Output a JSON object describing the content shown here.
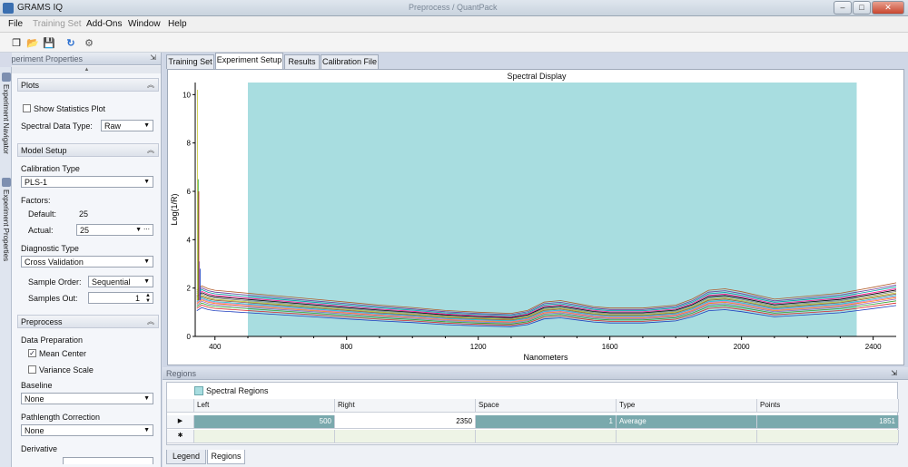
{
  "window": {
    "app_title": "GRAMS IQ",
    "doc_title": "Preprocess / QuantPack",
    "min": "–",
    "max": "□",
    "close": "✕"
  },
  "menu": [
    {
      "label": "File",
      "disabled": false
    },
    {
      "label": "Training Set",
      "disabled": true
    },
    {
      "label": "Add-Ons",
      "disabled": false
    },
    {
      "label": "Window",
      "disabled": false
    },
    {
      "label": "Help",
      "disabled": false
    }
  ],
  "toolbar": {
    "new_icon": "❐",
    "open_icon": "📂",
    "save_icon": "💾",
    "refresh_icon": "↻",
    "settings_icon": "⚙"
  },
  "side_tabs": {
    "navigator": "Experiment Navigator",
    "properties": "Experiment Properties"
  },
  "panel": {
    "title": "Experiment Properties",
    "pin": "⇲",
    "plots": {
      "header": "Plots",
      "show_statistics_label": "Show Statistics Plot",
      "show_statistics_checked": false,
      "spectral_type_label": "Spectral Data Type:",
      "spectral_type_value": "Raw"
    },
    "model": {
      "header": "Model Setup",
      "calibration_type_label": "Calibration Type",
      "calibration_type_value": "PLS-1",
      "factors_label": "Factors:",
      "default_label": "Default:",
      "default_value": "25",
      "actual_label": "Actual:",
      "actual_value": "25",
      "diagnostic_label": "Diagnostic Type",
      "diagnostic_value": "Cross Validation",
      "sample_order_label": "Sample Order:",
      "sample_order_value": "Sequential",
      "samples_out_label": "Samples Out:",
      "samples_out_value": "1"
    },
    "preprocess": {
      "header": "Preprocess",
      "data_prep_label": "Data Preparation",
      "mean_center_label": "Mean Center",
      "mean_center_checked": true,
      "variance_scale_label": "Variance Scale",
      "variance_scale_checked": false,
      "baseline_label": "Baseline",
      "baseline_value": "None",
      "pathlength_label": "Pathlength Correction",
      "pathlength_value": "None",
      "derivative_label": "Derivative"
    }
  },
  "doc_tabs": [
    {
      "label": "Training Set",
      "active": false
    },
    {
      "label": "Experiment Setup",
      "active": true
    },
    {
      "label": "Results",
      "active": false
    },
    {
      "label": "Calibration File",
      "active": false
    }
  ],
  "chart_data": {
    "type": "line",
    "title": "Spectral Display",
    "xlabel": "Nanometers",
    "ylabel": "Log(1/R)",
    "xlim": [
      340,
      2470
    ],
    "ylim": [
      0,
      10.5
    ],
    "x_ticks": [
      400,
      800,
      1200,
      1600,
      2000,
      2400
    ],
    "y_ticks": [
      0,
      2,
      4,
      6,
      8,
      10
    ],
    "shaded_region": {
      "x_start": 500,
      "x_end": 2350,
      "color": "#a8dde0"
    },
    "series_colors": [
      "#1f3fbf",
      "#d62728",
      "#2ca02c",
      "#9467bd",
      "#ff7f0e",
      "#e377c2",
      "#17becf",
      "#8c564b",
      "#bcbd22",
      "#7f7f7f",
      "#000000",
      "#ff1493",
      "#00a0a0",
      "#6a3d9a",
      "#b15928"
    ],
    "representative_curve": {
      "x": [
        345,
        360,
        380,
        400,
        500,
        600,
        700,
        800,
        900,
        1000,
        1100,
        1200,
        1300,
        1350,
        1400,
        1450,
        1500,
        1550,
        1600,
        1700,
        1800,
        1850,
        1900,
        1950,
        2000,
        2100,
        2200,
        2300,
        2350,
        2400,
        2470
      ],
      "y": [
        1.4,
        1.55,
        1.45,
        1.4,
        1.3,
        1.2,
        1.1,
        1.0,
        0.9,
        0.82,
        0.72,
        0.66,
        0.62,
        0.72,
        1.0,
        1.05,
        0.95,
        0.85,
        0.8,
        0.8,
        0.9,
        1.1,
        1.4,
        1.45,
        1.35,
        1.1,
        1.2,
        1.3,
        1.4,
        1.5,
        1.65
      ]
    }
  },
  "regions": {
    "title": "Regions",
    "pin": "⇲",
    "group_label": "Spectral Regions",
    "columns": [
      "Left",
      "Right",
      "Space",
      "Type",
      "Points"
    ],
    "rows": [
      {
        "left": "500",
        "right": "2350",
        "space": "1",
        "type": "Average",
        "points": "1851"
      }
    ],
    "row_marker": "▶",
    "new_row_marker": "✱"
  },
  "bottom_tabs": [
    {
      "label": "Legend",
      "active": false
    },
    {
      "label": "Regions",
      "active": true
    }
  ]
}
